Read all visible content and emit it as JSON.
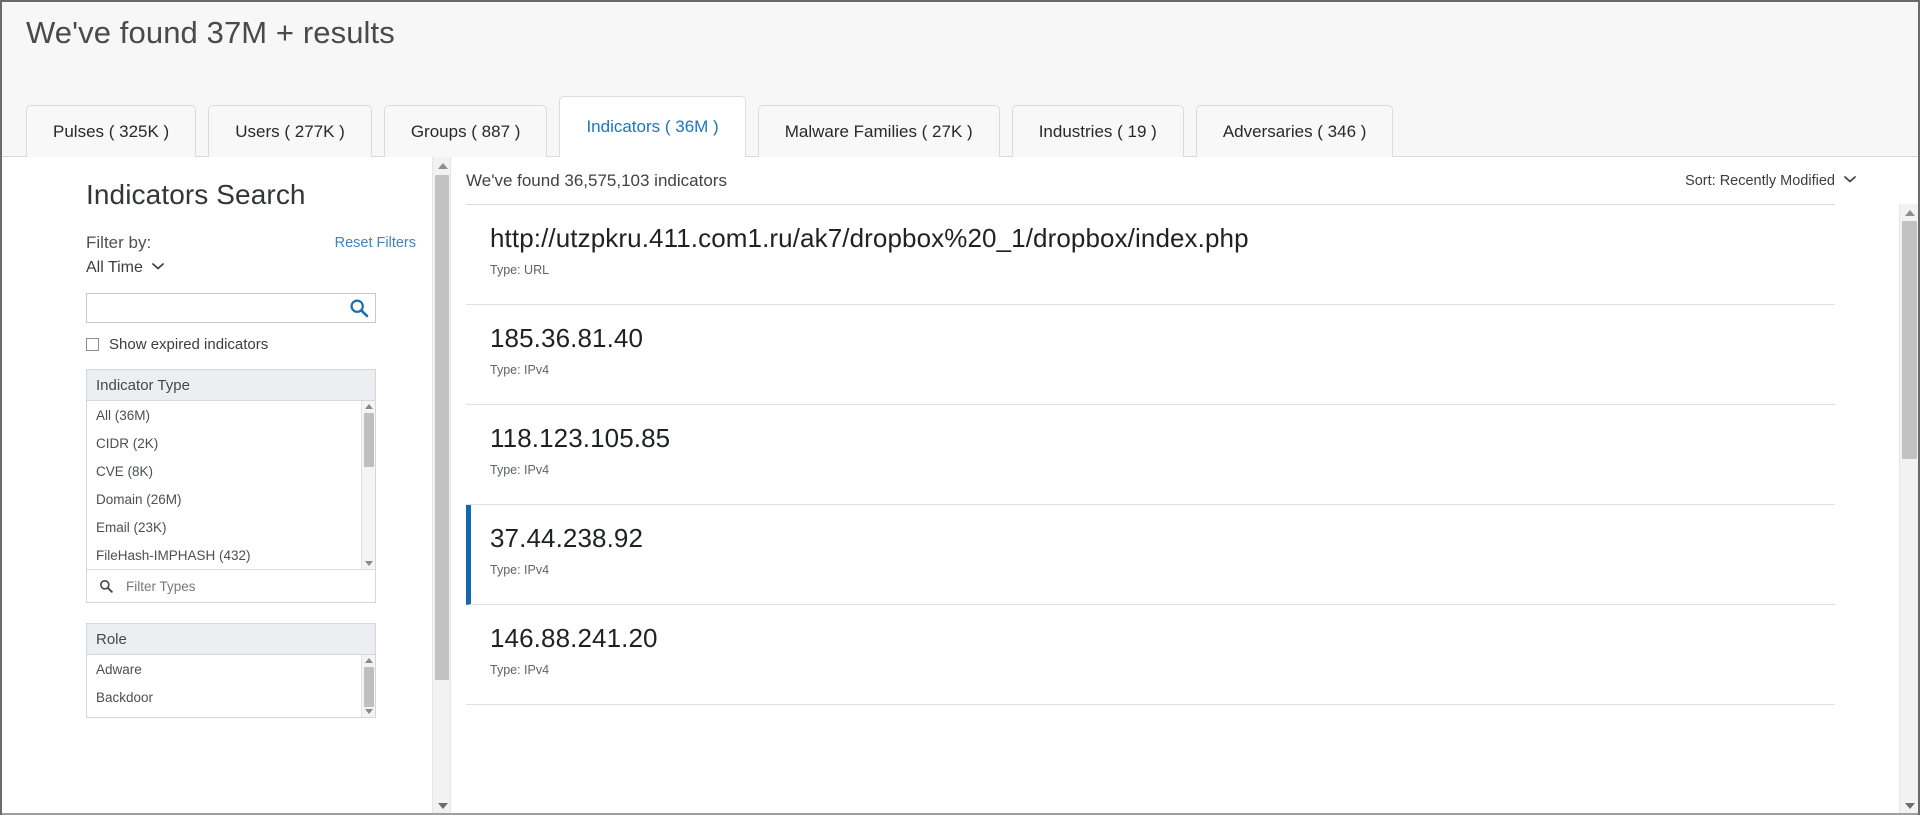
{
  "header": {
    "title": "We've found 37M + results"
  },
  "tabs": [
    {
      "label": "Pulses ( 325K )",
      "active": false
    },
    {
      "label": "Users ( 277K )",
      "active": false
    },
    {
      "label": "Groups ( 887 )",
      "active": false
    },
    {
      "label": "Indicators ( 36M )",
      "active": true
    },
    {
      "label": "Malware Families ( 27K )",
      "active": false
    },
    {
      "label": "Industries ( 19 )",
      "active": false
    },
    {
      "label": "Adversaries ( 346 )",
      "active": false
    }
  ],
  "sidebar": {
    "title": "Indicators Search",
    "filter_by_label": "Filter by:",
    "reset_filters_label": "Reset Filters",
    "time_range": "All Time",
    "search": {
      "value": "",
      "placeholder": ""
    },
    "show_expired_label": "Show expired indicators",
    "show_expired_checked": false,
    "facets": [
      {
        "title": "Indicator Type",
        "items": [
          "All (36M)",
          "CIDR (2K)",
          "CVE (8K)",
          "Domain (26M)",
          "Email (23K)",
          "FileHash-IMPHASH (432)"
        ],
        "filter_placeholder": "Filter Types"
      },
      {
        "title": "Role",
        "items": [
          "Adware",
          "Backdoor"
        ]
      }
    ]
  },
  "results": {
    "count_text": "We've found 36,575,103 indicators",
    "sort_label": "Sort: Recently Modified",
    "type_prefix": "Type: ",
    "items": [
      {
        "value": "http://utzpkru.411.com1.ru/ak7/dropbox%20_1/dropbox/index.php",
        "type_line": "Type: URL",
        "selected": false
      },
      {
        "value": "185.36.81.40",
        "type_line": "Type: IPv4",
        "selected": false
      },
      {
        "value": "118.123.105.85",
        "type_line": "Type: IPv4",
        "selected": false
      },
      {
        "value": "37.44.238.92",
        "type_line": "Type: IPv4",
        "selected": true
      },
      {
        "value": "146.88.241.20",
        "type_line": "Type: IPv4",
        "selected": false
      }
    ]
  },
  "colors": {
    "accent_blue": "#1b76bc",
    "link_blue": "#3e86bd",
    "selected_bar": "#1369ac",
    "header_bg": "#f7f7f8",
    "facet_header_bg": "#eceff1"
  }
}
